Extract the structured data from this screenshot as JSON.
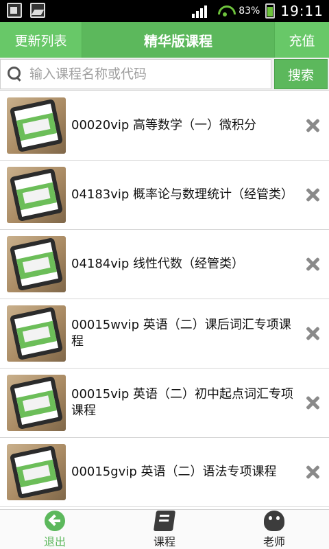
{
  "status_bar": {
    "battery_percent": "83%",
    "time": "19:11",
    "icons": [
      "notification-icon",
      "photo-icon",
      "mute-signal-icon",
      "wifi-icon",
      "battery-icon"
    ]
  },
  "header": {
    "left_label": "更新列表",
    "title": "精华版课程",
    "right_label": "充值"
  },
  "search": {
    "placeholder": "输入课程名称或代码",
    "button_label": "搜索"
  },
  "courses": [
    {
      "title": "00020vip 高等数学（一）微积分"
    },
    {
      "title": "04183vip 概率论与数理统计（经管类）"
    },
    {
      "title": "04184vip 线性代数（经管类）"
    },
    {
      "title": "00015wvip 英语（二）课后词汇专项课程"
    },
    {
      "title": "00015vip 英语（二）初中起点词汇专项课程"
    },
    {
      "title": "00015gvip 英语（二）语法专项课程"
    }
  ],
  "bottom_nav": {
    "items": [
      {
        "label": "退出",
        "icon": "exit-icon"
      },
      {
        "label": "课程",
        "icon": "book-icon"
      },
      {
        "label": "老师",
        "icon": "teacher-icon"
      }
    ]
  },
  "colors": {
    "accent": "#5cb85c",
    "header_button": "#68c868",
    "status_bar": "#000000"
  }
}
